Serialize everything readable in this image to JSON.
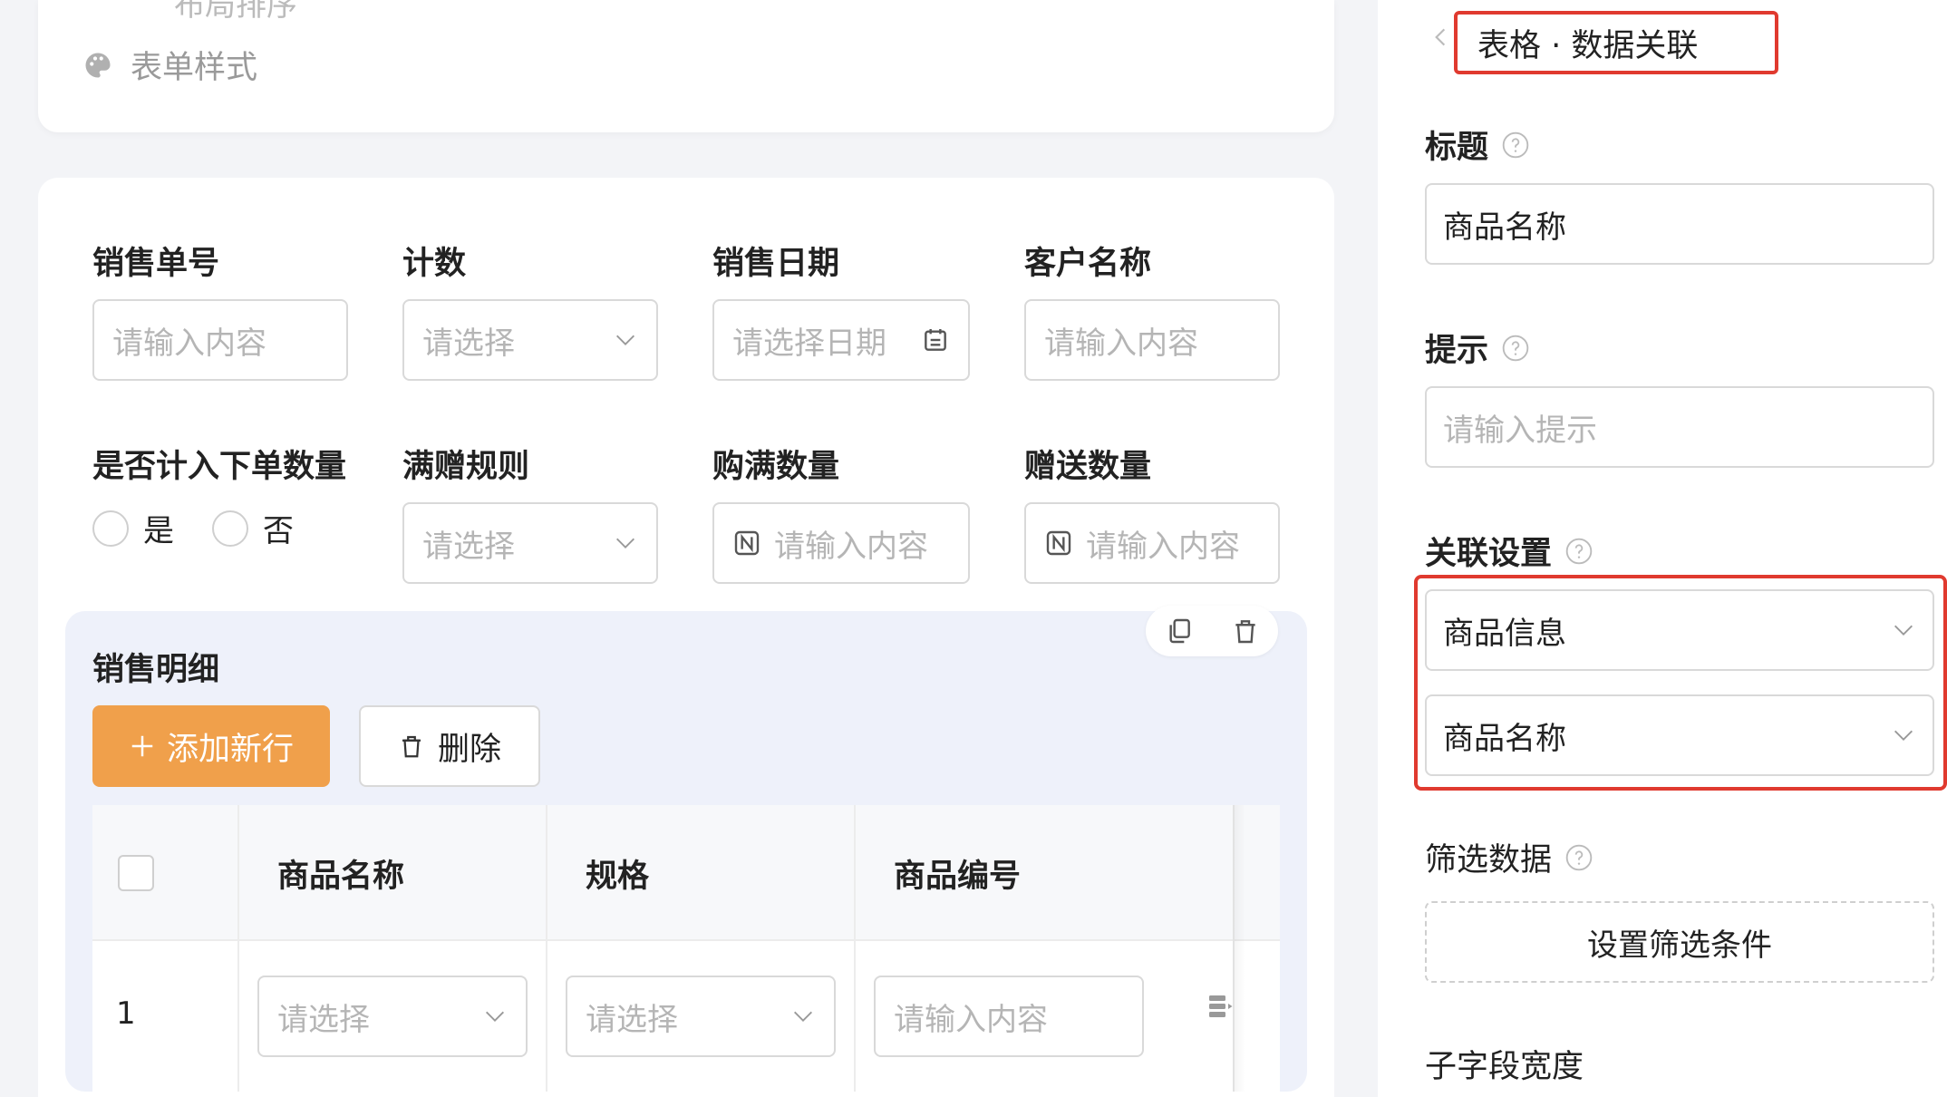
{
  "top_card": {
    "cut_text": "布局排序",
    "form_style_label": "表单样式"
  },
  "form": {
    "row1": [
      {
        "label": "销售单号",
        "placeholder": "请输入内容",
        "kind": "text"
      },
      {
        "label": "计数",
        "placeholder": "请选择",
        "kind": "select"
      },
      {
        "label": "销售日期",
        "placeholder": "请选择日期",
        "kind": "date"
      },
      {
        "label": "客户名称",
        "placeholder": "请输入内容",
        "kind": "text"
      }
    ],
    "row2": {
      "radio_label": "是否计入下单数量",
      "radio_yes": "是",
      "radio_no": "否",
      "rule_label": "满赠规则",
      "rule_placeholder": "请选择",
      "full_qty_label": "购满数量",
      "full_qty_placeholder": "请输入内容",
      "gift_qty_label": "赠送数量",
      "gift_qty_placeholder": "请输入内容"
    }
  },
  "sub_table": {
    "title": "销售明细",
    "add_button": "添加新行",
    "delete_button": "删除",
    "columns": [
      "商品名称",
      "规格",
      "商品编号"
    ],
    "row": {
      "index": "1",
      "product_placeholder": "请选择",
      "spec_placeholder": "请选择",
      "code_placeholder": "请输入内容"
    }
  },
  "right_panel": {
    "breadcrumb": "表格 · 数据关联",
    "title_label": "标题",
    "title_value": "商品名称",
    "hint_label": "提示",
    "hint_placeholder": "请输入提示",
    "relation_label": "关联设置",
    "relation_source": "商品信息",
    "relation_field": "商品名称",
    "filter_label": "筛选数据",
    "filter_button": "设置筛选条件",
    "subfield_width_label": "子字段宽度"
  },
  "colors": {
    "accent": "#f0a04b",
    "highlight": "#e03a2f",
    "placeholder": "#b5b5b5"
  }
}
